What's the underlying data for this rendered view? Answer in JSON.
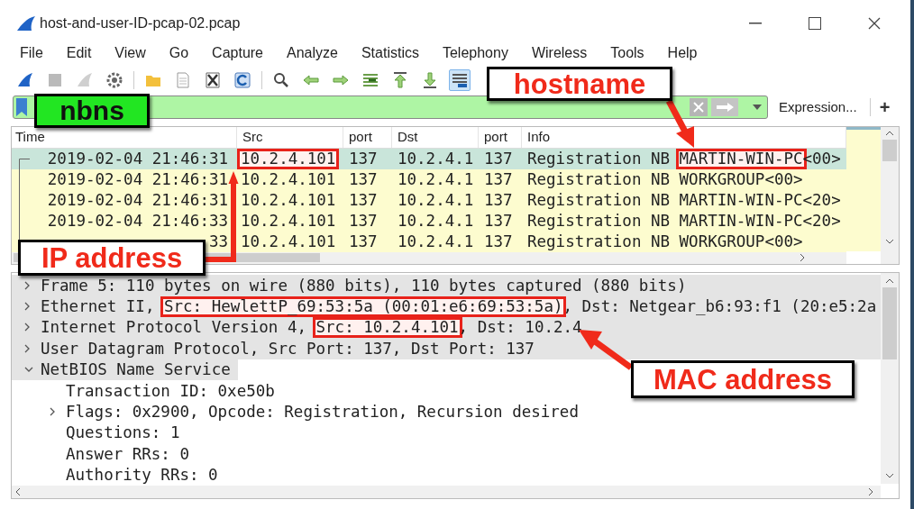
{
  "window": {
    "title": "host-and-user-ID-pcap-02.pcap"
  },
  "menu": [
    "File",
    "Edit",
    "View",
    "Go",
    "Capture",
    "Analyze",
    "Statistics",
    "Telephony",
    "Wireless",
    "Tools",
    "Help"
  ],
  "toolbar": [
    {
      "kind": "start",
      "disabled": false,
      "on": false
    },
    {
      "kind": "stop",
      "disabled": true,
      "on": false
    },
    {
      "kind": "restart",
      "disabled": true,
      "on": false
    },
    {
      "kind": "options",
      "disabled": false,
      "on": false
    },
    {
      "kind": "separator"
    },
    {
      "kind": "open",
      "disabled": false,
      "on": false
    },
    {
      "kind": "file",
      "disabled": false,
      "on": false
    },
    {
      "kind": "close",
      "disabled": false,
      "on": false
    },
    {
      "kind": "reload",
      "disabled": false,
      "on": false
    },
    {
      "kind": "separator"
    },
    {
      "kind": "find",
      "disabled": false,
      "on": false
    },
    {
      "kind": "back",
      "disabled": false,
      "on": false
    },
    {
      "kind": "forward",
      "disabled": false,
      "on": false
    },
    {
      "kind": "goto",
      "disabled": false,
      "on": false
    },
    {
      "kind": "first",
      "disabled": false,
      "on": false
    },
    {
      "kind": "last",
      "disabled": false,
      "on": false
    },
    {
      "kind": "autoscroll",
      "disabled": false,
      "on": true
    }
  ],
  "display_filter": {
    "expression_button": "Expression...",
    "add_button": "+"
  },
  "packet_list": {
    "columns": [
      "Time",
      "Src",
      "port",
      "Dst",
      "port",
      "Info"
    ],
    "rows": [
      {
        "selected": true,
        "cells": [
          [
            {
              "text": "2019-02-04 21:46:31",
              "boxed": false
            }
          ],
          [
            {
              "text": "10.2.4.101",
              "boxed": true
            }
          ],
          [
            {
              "text": "137",
              "boxed": false
            }
          ],
          [
            {
              "text": "10.2.4.1",
              "boxed": false
            }
          ],
          [
            {
              "text": "137",
              "boxed": false
            }
          ],
          [
            {
              "text": "Registration NB ",
              "boxed": false
            },
            {
              "text": "MARTIN-WIN-PC",
              "boxed": true
            },
            {
              "text": "<00>",
              "boxed": false
            }
          ]
        ]
      },
      {
        "selected": false,
        "cells": [
          [
            {
              "text": "2019-02-04 21:46:31",
              "boxed": false
            }
          ],
          [
            {
              "text": "10.2.4.101",
              "boxed": false
            }
          ],
          [
            {
              "text": "137",
              "boxed": false
            }
          ],
          [
            {
              "text": "10.2.4.1",
              "boxed": false
            }
          ],
          [
            {
              "text": "137",
              "boxed": false
            }
          ],
          [
            {
              "text": "Registration NB WORKGROUP<00>",
              "boxed": false
            }
          ]
        ]
      },
      {
        "selected": false,
        "cells": [
          [
            {
              "text": "2019-02-04 21:46:31",
              "boxed": false
            }
          ],
          [
            {
              "text": "10.2.4.101",
              "boxed": false
            }
          ],
          [
            {
              "text": "137",
              "boxed": false
            }
          ],
          [
            {
              "text": "10.2.4.1",
              "boxed": false
            }
          ],
          [
            {
              "text": "137",
              "boxed": false
            }
          ],
          [
            {
              "text": "Registration NB MARTIN-WIN-PC<20>",
              "boxed": false
            }
          ]
        ]
      },
      {
        "selected": false,
        "cells": [
          [
            {
              "text": "2019-02-04 21:46:33",
              "boxed": false
            }
          ],
          [
            {
              "text": "10.2.4.101",
              "boxed": false
            }
          ],
          [
            {
              "text": "137",
              "boxed": false
            }
          ],
          [
            {
              "text": "10.2.4.1",
              "boxed": false
            }
          ],
          [
            {
              "text": "137",
              "boxed": false
            }
          ],
          [
            {
              "text": "Registration NB MARTIN-WIN-PC<20>",
              "boxed": false
            }
          ]
        ]
      },
      {
        "selected": false,
        "cells": [
          [
            {
              "text": "33",
              "boxed": false
            }
          ],
          [
            {
              "text": "10.2.4.101",
              "boxed": false
            }
          ],
          [
            {
              "text": "137",
              "boxed": false
            }
          ],
          [
            {
              "text": "10.2.4.1",
              "boxed": false
            }
          ],
          [
            {
              "text": "137",
              "boxed": false
            }
          ],
          [
            {
              "text": "Registration NB WORKGROUP<00>",
              "boxed": false
            }
          ]
        ]
      }
    ]
  },
  "packet_details": [
    {
      "expanded": false,
      "parts": [
        {
          "text": "Frame 5: 110 bytes on wire (880 bits), 110 bytes captured (880 bits)",
          "boxed": false
        }
      ]
    },
    {
      "expanded": false,
      "parts": [
        {
          "text": "Ethernet II, ",
          "boxed": false
        },
        {
          "text": "Src: HewlettP_69:53:5a (00:01:e6:69:53:5a)",
          "boxed": true
        },
        {
          "text": ", Dst: Netgear_b6:93:f1 (20:e5:2a",
          "boxed": false
        }
      ]
    },
    {
      "expanded": false,
      "parts": [
        {
          "text": "Internet Protocol Version 4, ",
          "boxed": false
        },
        {
          "text": "Src: 10.2.4.101",
          "boxed": true
        },
        {
          "text": ", Dst: 10.2.4",
          "boxed": false
        }
      ]
    },
    {
      "expanded": false,
      "parts": [
        {
          "text": "User Datagram Protocol, Src Port: 137, Dst Port: 137",
          "boxed": false
        }
      ]
    },
    {
      "expanded": true,
      "parts": [
        {
          "text": "NetBIOS Name Service",
          "boxed": false
        }
      ],
      "children": [
        {
          "parts": [
            {
              "text": "Transaction ID: 0xe50b",
              "boxed": false
            }
          ]
        },
        {
          "expanded": false,
          "parts": [
            {
              "text": "Flags: 0x2900, Opcode: Registration, Recursion desired",
              "boxed": false
            }
          ]
        },
        {
          "parts": [
            {
              "text": "Questions: 1",
              "boxed": false
            }
          ]
        },
        {
          "parts": [
            {
              "text": "Answer RRs: 0",
              "boxed": false
            }
          ]
        },
        {
          "parts": [
            {
              "text": "Authority RRs: 0",
              "boxed": false
            }
          ]
        }
      ]
    }
  ],
  "callouts": [
    {
      "kind": "filter",
      "text": "nbns"
    },
    {
      "kind": "hostname",
      "text": "hostname"
    },
    {
      "kind": "ip",
      "text": "IP address"
    },
    {
      "kind": "mac",
      "text": "MAC address"
    }
  ]
}
